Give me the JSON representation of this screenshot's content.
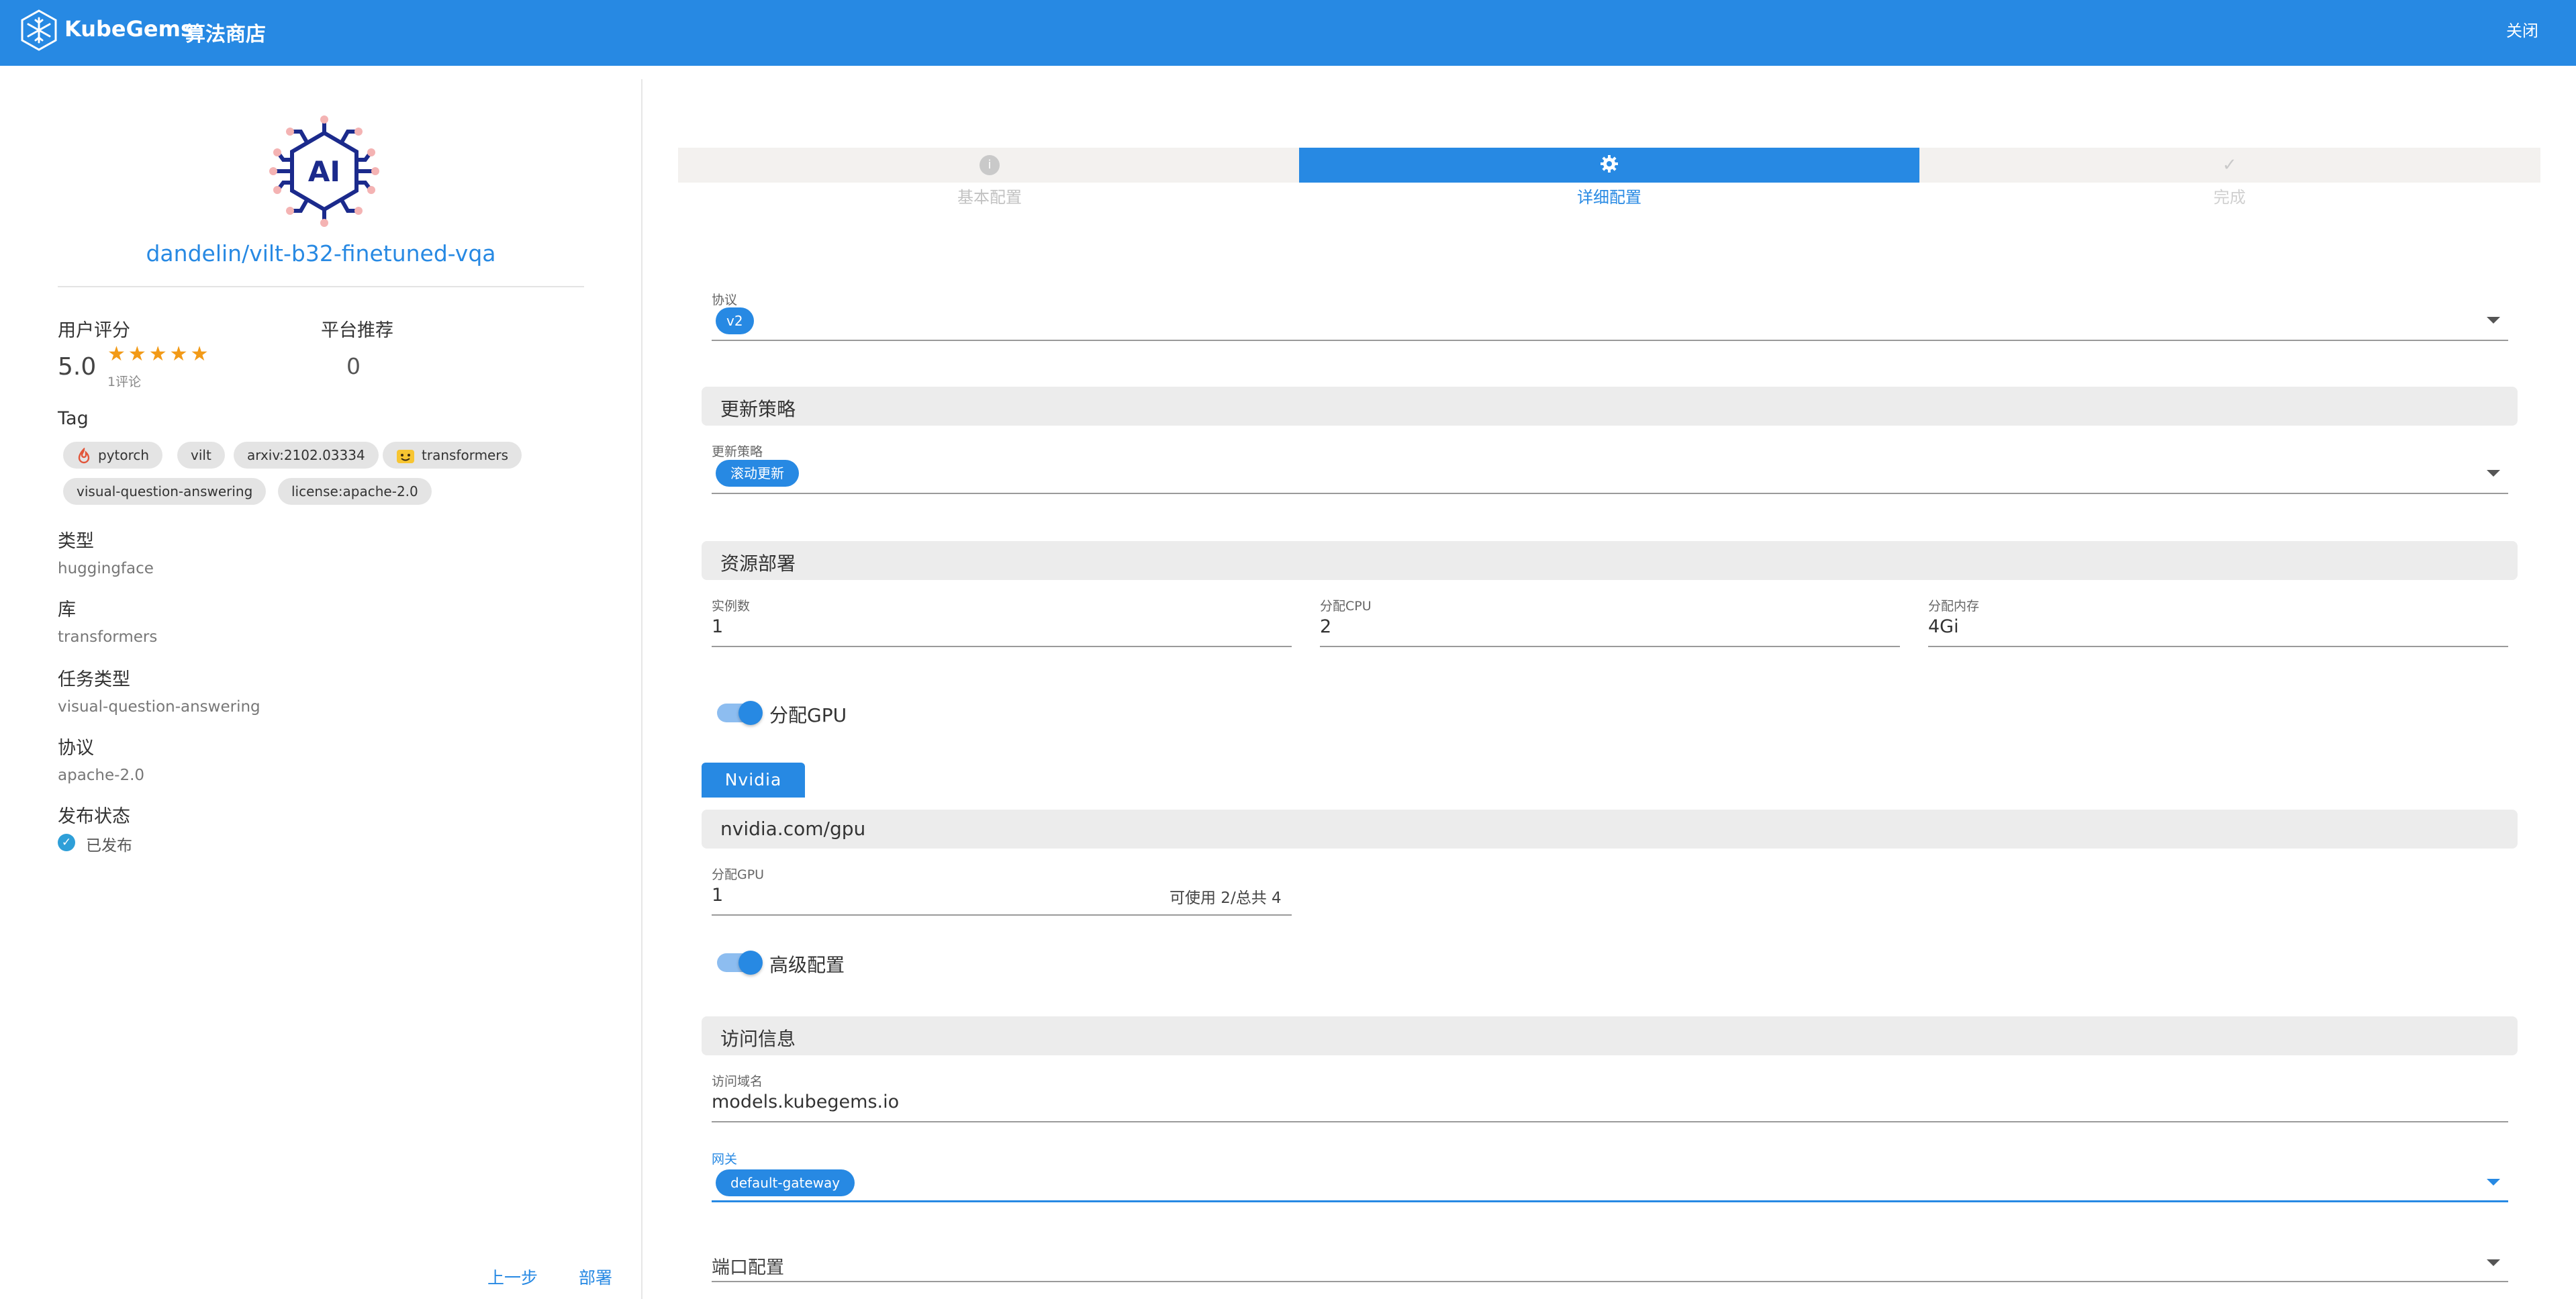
{
  "header": {
    "brand": "KubeGems",
    "subtitle": "算法商店",
    "close_label": "关闭"
  },
  "model": {
    "title": "dandelin/vilt-b32-finetuned-vqa",
    "logo_text": "AI",
    "rating_label": "用户评分",
    "rating_value": "5.0",
    "stars": "★★★★★",
    "review_count": "1评论",
    "recommend_label": "平台推荐",
    "recommend_value": "0",
    "tag_label": "Tag",
    "tags": [
      {
        "label": "pytorch",
        "icon": "flame-icon"
      },
      {
        "label": "vilt",
        "icon": ""
      },
      {
        "label": "arxiv:2102.03334",
        "icon": ""
      },
      {
        "label": "transformers",
        "icon": "hugging-face-icon"
      },
      {
        "label": "visual-question-answering",
        "icon": ""
      },
      {
        "label": "license:apache-2.0",
        "icon": ""
      }
    ],
    "type_label": "类型",
    "type_value": "huggingface",
    "library_label": "库",
    "library_value": "transformers",
    "task_label": "任务类型",
    "task_value": "visual-question-answering",
    "license_label": "协议",
    "license_value": "apache-2.0",
    "publish_label": "发布状态",
    "publish_value": "已发布"
  },
  "footer": {
    "prev_label": "上一步",
    "deploy_label": "部署"
  },
  "steps": [
    {
      "label": "基本配置",
      "icon": "info-icon",
      "state": "done"
    },
    {
      "label": "详细配置",
      "icon": "gear-icon",
      "state": "active"
    },
    {
      "label": "完成",
      "icon": "check-icon",
      "state": "pending"
    }
  ],
  "form": {
    "protocol_label": "协议",
    "protocol_value": "v2",
    "update_section": "更新策略",
    "update_label": "更新策略",
    "update_value": "滚动更新",
    "resource_section": "资源部署",
    "replicas_label": "实例数",
    "replicas_value": "1",
    "cpu_label": "分配CPU",
    "cpu_value": "2",
    "memory_label": "分配内存",
    "memory_value": "4Gi",
    "gpu_toggle_label": "分配GPU",
    "gpu_tab": "Nvidia",
    "gpu_resource_section": "nvidia.com/gpu",
    "gpu_label": "分配GPU",
    "gpu_value": "1",
    "gpu_available": "可使用 2/总共 4",
    "advanced_toggle_label": "高级配置",
    "access_section": "访问信息",
    "domain_label": "访问域名",
    "domain_value": "models.kubegems.io",
    "gateway_label": "网关",
    "gateway_value": "default-gateway",
    "port_label": "端口配置"
  },
  "colors": {
    "accent": "#2789e3",
    "star": "#f29a17"
  }
}
